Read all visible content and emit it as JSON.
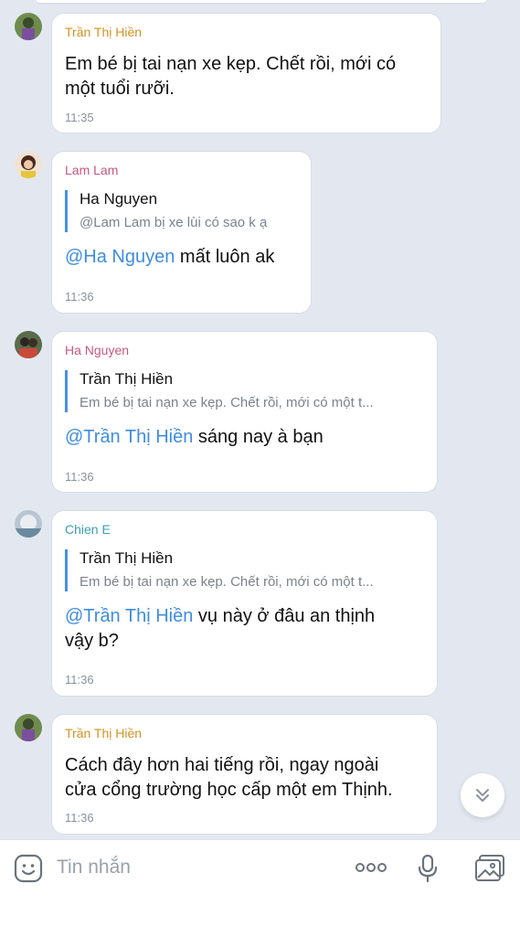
{
  "messages": [
    {
      "sender": "Trần Thị Hiền",
      "sender_color": "#d4921e",
      "text_lines": [
        "Em bé bị tai nạn xe kẹp. Chết rồi, mới có",
        "một tuổi rưỡi."
      ],
      "time": "11:35"
    },
    {
      "sender": "Lam Lam",
      "sender_color": "#c8577c",
      "quote": {
        "name": "Ha Nguyen",
        "text": "@Lam Lam bị xe lùi có sao k ạ"
      },
      "mention": "@Ha Nguyen",
      "text_lines": [
        " mất luôn ak"
      ],
      "time": "11:36"
    },
    {
      "sender": "Ha Nguyen",
      "sender_color": "#c8577c",
      "quote": {
        "name": "Trần Thị Hiền",
        "text": "Em bé bị tai nạn xe kẹp. Chết rồi, mới có một t..."
      },
      "mention": "@Trần Thị Hiền",
      "text_lines": [
        " sáng nay à bạn"
      ],
      "time": "11:36"
    },
    {
      "sender": "Chien E",
      "sender_color": "#3aa0b4",
      "quote": {
        "name": "Trần Thị Hiền",
        "text": "Em bé bị tai nạn xe kẹp. Chết rồi, mới có một t..."
      },
      "mention": "@Trần Thị Hiền",
      "text_lines": [
        " vụ này ở đâu an thịnh",
        "vậy b?"
      ],
      "time": "11:36"
    },
    {
      "sender": "Trần Thị Hiền",
      "sender_color": "#d4921e",
      "text_lines": [
        "Cách đây hơn hai tiếng rồi, ngay ngoài",
        "cửa cổng trường học cấp một em Thịnh."
      ],
      "time": "11:36"
    }
  ],
  "composer": {
    "placeholder": "Tin nhắn",
    "icons": [
      "sticker-icon",
      "more-options-icon",
      "microphone-icon",
      "image-icon"
    ]
  },
  "scroll_button_icon": "double-chevron-down-icon",
  "colors": {
    "background": "#e3e8f0",
    "mention": "#3d8de0",
    "quote_bar": "#4a90e2"
  }
}
